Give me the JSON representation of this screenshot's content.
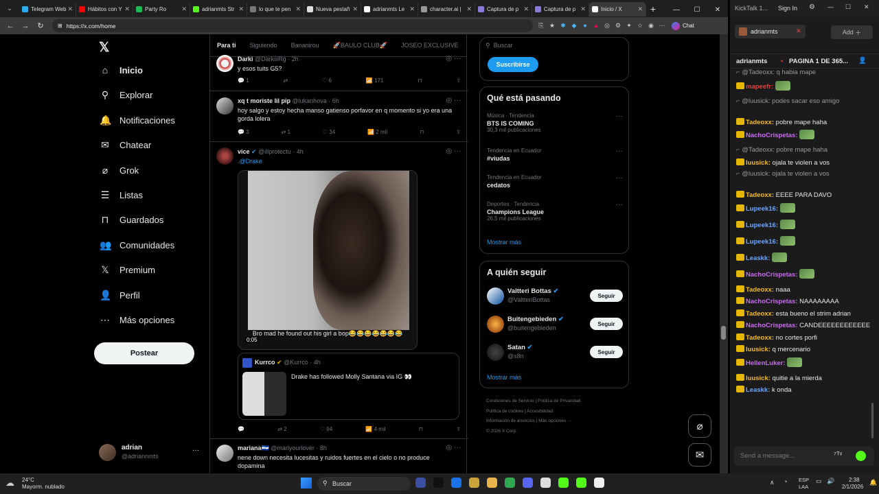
{
  "browser": {
    "tabs": [
      {
        "label": "Telegram Web",
        "color": "#2aabee"
      },
      {
        "label": "Hábitos con Y",
        "color": "#ff0000"
      },
      {
        "label": "Party Ro",
        "color": "#1db954"
      },
      {
        "label": "adrianmts Str",
        "color": "#53fc18"
      },
      {
        "label": "lo que te pen",
        "color": "#777777"
      },
      {
        "label": "Nueva pestañ",
        "color": "#dddddd"
      },
      {
        "label": "adrianmts Le",
        "color": "#ffffff"
      },
      {
        "label": "character.ai |",
        "color": "#999999"
      },
      {
        "label": "Captura de p",
        "color": "#8a7bd8"
      },
      {
        "label": "Captura de p",
        "color": "#8a7bd8"
      },
      {
        "label": "Inicio / X",
        "color": "#ffffff"
      }
    ],
    "url": "https://x.com/home",
    "chat_label": "Chat"
  },
  "x": {
    "nav": [
      "Inicio",
      "Explorar",
      "Notificaciones",
      "Chatear",
      "Grok",
      "Listas",
      "Guardados",
      "Comunidades",
      "Premium",
      "Perfil",
      "Más opciones"
    ],
    "post_button": "Postear",
    "account": {
      "name": "adrian",
      "handle": "@adriannmts"
    },
    "feed_tabs": [
      "Para ti",
      "Siguiendo",
      "Bananirou",
      "🚀BAULO CLUB🚀",
      "JOSEO EXCLUSIVE"
    ],
    "tweets": [
      {
        "name": "Darki",
        "handle": "@DarkiiiRg · 2h",
        "text": "y esos tuits G5?",
        "replies": "1",
        "rts": "",
        "likes": "6",
        "views": "171"
      },
      {
        "name": "xq t moriste lil pip",
        "handle": "@lukanhova · 6h",
        "text": "hoy salgo y estoy hecha manso gatienso porfavor en q momento si yo era una gorda lolera",
        "replies": "3",
        "rts": "1",
        "likes": "34",
        "views": "2 mil"
      },
      {
        "name": "vice",
        "handle": "@illprotectu · 4h",
        "text": ".@Drake",
        "video_caption": "Bro mad he found out his girl a bop😂😂😂😂😂😂😂",
        "video_time": "0:05",
        "quote": {
          "name": "Kurrco",
          "handle": "@Kurrco · 4h",
          "text": "Drake has followed Molly Santana via IG 👀"
        },
        "replies": "",
        "rts": "2",
        "likes": "94",
        "views": "4 mil"
      },
      {
        "name": "mariana🇸🇻",
        "handle": "@marlyourlover · 8h",
        "text": "nene down necesita lucesitas y ruidos fuertes en el cielo o no produce dopamina"
      }
    ],
    "search_placeholder": "Buscar",
    "subscribe": "Suscribirse",
    "trending_title": "Qué está pasando",
    "trends": [
      {
        "meta": "Música · Tendencia",
        "title": "BTS IS COMING",
        "count": "30,3 mil publicaciones"
      },
      {
        "meta": "Tendencia en Ecuador",
        "title": "#viudas",
        "count": ""
      },
      {
        "meta": "Tendencia en Ecuador",
        "title": "cedatos",
        "count": ""
      },
      {
        "meta": "Deportes · Tendencia",
        "title": "Champions League",
        "count": "26,5 mil publicaciones"
      }
    ],
    "show_more": "Mostrar más",
    "follow_title": "A quién seguir",
    "follow": [
      {
        "name": "Valtteri Bottas",
        "handle": "@ValtteriBottas",
        "btn": "Seguir"
      },
      {
        "name": "Buitengebieden",
        "handle": "@buitengebieden",
        "btn": "Seguir"
      },
      {
        "name": "Satan",
        "handle": "@s8n",
        "btn": "Seguir"
      }
    ],
    "footer": [
      "Condiciones de Servicio",
      "Política de Privacidad",
      "Política de cookies",
      "Accesibilidad",
      "Información de anuncios",
      "Más opciones ···",
      "© 2026 X Corp."
    ]
  },
  "kick": {
    "title": "KickTalk 1...",
    "signin": "Sign In",
    "channel_tab": "adrianmts",
    "add": "Add",
    "header": "adrianmts",
    "page": "PAGINA 1 DE 365...",
    "messages": [
      {
        "user": "",
        "text": "@Tadeoxx: q habia mape",
        "reply": true,
        "color": "#aaaaaa"
      },
      {
        "user": "mapeefr:",
        "text": "",
        "color": "#e0413e",
        "emote": true
      },
      {
        "user": "",
        "text": "@luusick: podes sacar eso amigo",
        "reply": true,
        "color": "#aaaaaa"
      },
      {
        "user": "Tadeoxx:",
        "text": "pobre mape haha",
        "color": "#f5b922"
      },
      {
        "user": "NachoCrispetas:",
        "text": "",
        "color": "#c86cf0",
        "emote": true
      },
      {
        "user": "",
        "text": "@Tadeoxx: pobre mape haha",
        "reply": true,
        "color": "#aaaaaa"
      },
      {
        "user": "luusick:",
        "text": "ojala te violen a vos",
        "color": "#f5b922"
      },
      {
        "user": "",
        "text": "@luusick: ojala te violen a vos",
        "reply": true,
        "color": "#aaaaaa"
      },
      {
        "user": "Tadeoxx:",
        "text": "EEEE PARA DAVO",
        "color": "#f5b922"
      },
      {
        "user": "Lupeek16:",
        "text": "",
        "color": "#6aa6ff",
        "emote": true
      },
      {
        "user": "Lupeek16:",
        "text": "",
        "color": "#6aa6ff",
        "emote": true
      },
      {
        "user": "Lupeek16:",
        "text": "",
        "color": "#6aa6ff",
        "emote": true
      },
      {
        "user": "Leaskk:",
        "text": "",
        "color": "#6aa6ff",
        "emote": true
      },
      {
        "user": "NachoCrispetas:",
        "text": "",
        "color": "#c86cf0",
        "emote": true
      },
      {
        "user": "Tadeoxx:",
        "text": "naaa",
        "color": "#f5b922"
      },
      {
        "user": "NachoCrispetas:",
        "text": "NAAAAAAAA",
        "color": "#c86cf0"
      },
      {
        "user": "Tadeoxx:",
        "text": "esta bueno el strim adrian",
        "color": "#f5b922"
      },
      {
        "user": "NachoCrispetas:",
        "text": "CANDEEEEEEEEEEEE",
        "color": "#c86cf0"
      },
      {
        "user": "Tadeoxx:",
        "text": "no cortes porfi",
        "color": "#f5b922"
      },
      {
        "user": "luusick:",
        "text": "q mercenario",
        "color": "#f5b922"
      },
      {
        "user": "HellenLuker:",
        "text": "",
        "color": "#c86cf0",
        "emote": true
      },
      {
        "user": "luusick:",
        "text": "quitie a la mierda",
        "color": "#f5b922"
      },
      {
        "user": "Leaskk:",
        "text": "k onda",
        "color": "#6aa6ff"
      }
    ],
    "input_placeholder": "Send a message..."
  },
  "taskbar": {
    "temp": "24°C",
    "weather": "Mayorm. nublado",
    "search": "Buscar",
    "lang": "ESP",
    "lang2": "LAA",
    "time": "2:38",
    "date": "2/1/2026"
  }
}
